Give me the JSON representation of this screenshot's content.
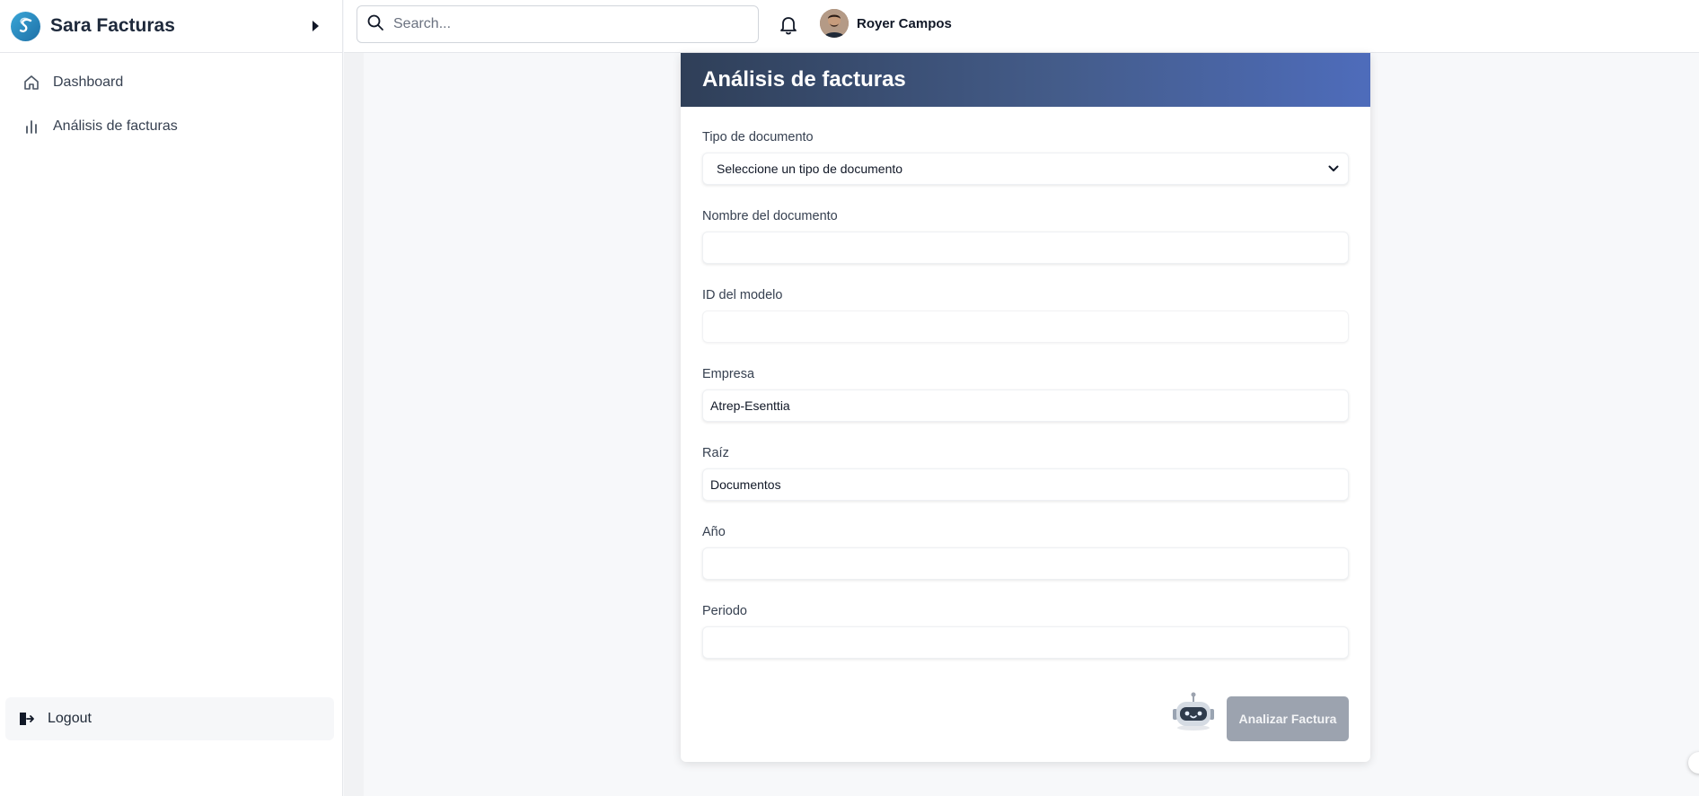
{
  "app": {
    "name": "Sara Facturas"
  },
  "sidebar": {
    "items": [
      {
        "label": "Dashboard",
        "icon": "home-icon"
      },
      {
        "label": "Análisis de facturas",
        "icon": "bar-chart-icon"
      }
    ],
    "logout_label": "Logout"
  },
  "topbar": {
    "search_placeholder": "Search...",
    "user_name": "Royer Campos"
  },
  "form": {
    "title": "Análisis de facturas",
    "fields": {
      "tipo_documento": {
        "label": "Tipo de documento",
        "value": "Seleccione un tipo de documento"
      },
      "nombre_documento": {
        "label": "Nombre del documento",
        "value": ""
      },
      "id_modelo": {
        "label": "ID del modelo",
        "value": ""
      },
      "empresa": {
        "label": "Empresa",
        "value": "Atrep-Esenttia"
      },
      "raiz": {
        "label": "Raíz",
        "value": "Documentos"
      },
      "anio": {
        "label": "Año",
        "value": ""
      },
      "periodo": {
        "label": "Periodo",
        "value": ""
      }
    },
    "submit_label": "Analizar Factura"
  },
  "colors": {
    "header_start": "#2f3f58",
    "header_end": "#4e6cbb",
    "button_disabled": "#9ca3af",
    "logo": "#2b8cc4"
  }
}
